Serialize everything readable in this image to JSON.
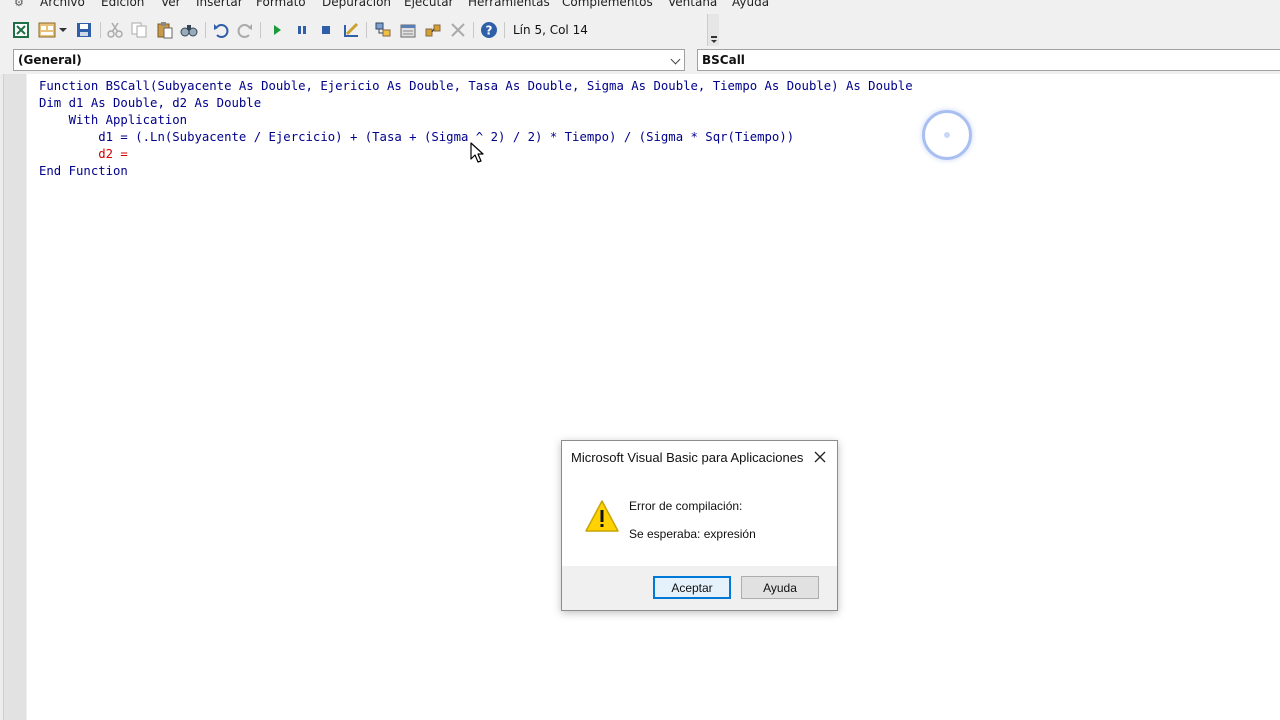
{
  "menu": {
    "items": [
      "Archivo",
      "Edición",
      "Ver",
      "Insertar",
      "Formato",
      "Depuración",
      "Ejecutar",
      "Herramientas",
      "Complementos",
      "Ventana",
      "Ayuda"
    ]
  },
  "toolbar": {
    "cursor_position": "Lín 5, Col 14"
  },
  "code_window": {
    "object_combo": "(General)",
    "procedure_combo": "BSCall"
  },
  "code": {
    "line1": "Function BSCall(Subyacente As Double, Ejericio As Double, Tasa As Double, Sigma As Double, Tiempo As Double) As Double",
    "line2": "Dim d1 As Double, d2 As Double",
    "line3": "    With Application",
    "line4": "        d1 = (.Ln(Subyacente / Ejercicio) + (Tasa + (Sigma ^ 2) / 2) * Tiempo) / (Sigma * Sqr(Tiempo))",
    "line5": "        d2 =",
    "line6": "End Function"
  },
  "dialog": {
    "title": "Microsoft Visual Basic para Aplicaciones",
    "message_line1": "Error de compilación:",
    "message_line2": "Se esperaba: expresión",
    "ok_label": "Aceptar",
    "help_label": "Ayuda",
    "icon": "warning-icon"
  },
  "colors": {
    "keyword": "#00008b",
    "error_line": "#d40000",
    "default_button_border": "#0078d7"
  }
}
